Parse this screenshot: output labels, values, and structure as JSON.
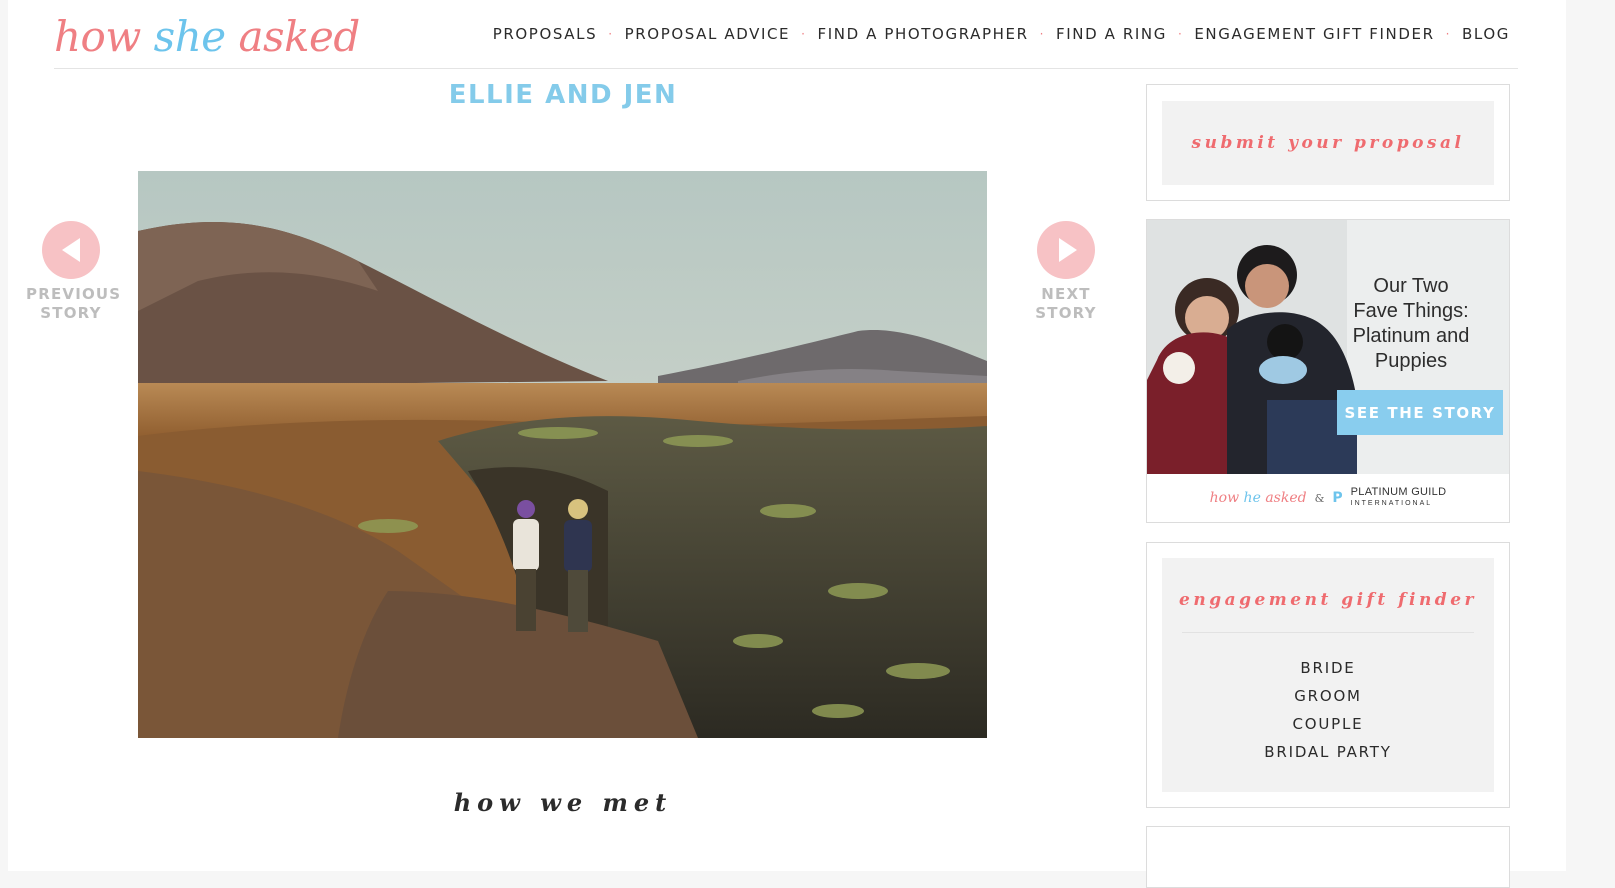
{
  "logo": {
    "word1": "how",
    "word2": "she",
    "word3": "asked"
  },
  "nav": {
    "items": [
      {
        "label": "PROPOSALS"
      },
      {
        "label": "PROPOSAL ADVICE"
      },
      {
        "label": "FIND A PHOTOGRAPHER"
      },
      {
        "label": "FIND A RING"
      },
      {
        "label": "ENGAGEMENT GIFT FINDER"
      },
      {
        "label": "BLOG"
      }
    ],
    "separator": "·"
  },
  "story": {
    "title": "ELLIE AND JEN",
    "section_heading": "how we met",
    "prev_line1": "PREVIOUS",
    "prev_line2": "STORY",
    "next_line1": "NEXT",
    "next_line2": "STORY"
  },
  "sidebar": {
    "submit_title": "submit your proposal",
    "ad": {
      "headline_line1": "Our Two",
      "headline_line2": "Fave Things:",
      "headline_line3": "Platinum and",
      "headline_line4": "Puppies",
      "button_label": "SEE THE STORY",
      "footer_logo_1": "how",
      "footer_logo_2": "he",
      "footer_logo_3": "asked",
      "footer_amp": "&",
      "footer_partner_mark": "P",
      "footer_partner_line1": "PLATINUM GUILD",
      "footer_partner_line2": "INTERNATIONAL"
    },
    "gift_finder": {
      "title": "engagement gift finder",
      "links": [
        "BRIDE",
        "GROOM",
        "COUPLE",
        "BRIDAL PARTY"
      ]
    }
  },
  "colors": {
    "brand_pink": "#ef7f83",
    "brand_blue": "#6dc4ec",
    "arrow_pink": "#f7c2c5",
    "title_blue": "#84cbea"
  },
  "icons": {
    "prev": "triangle-left-icon",
    "next": "triangle-right-icon"
  }
}
